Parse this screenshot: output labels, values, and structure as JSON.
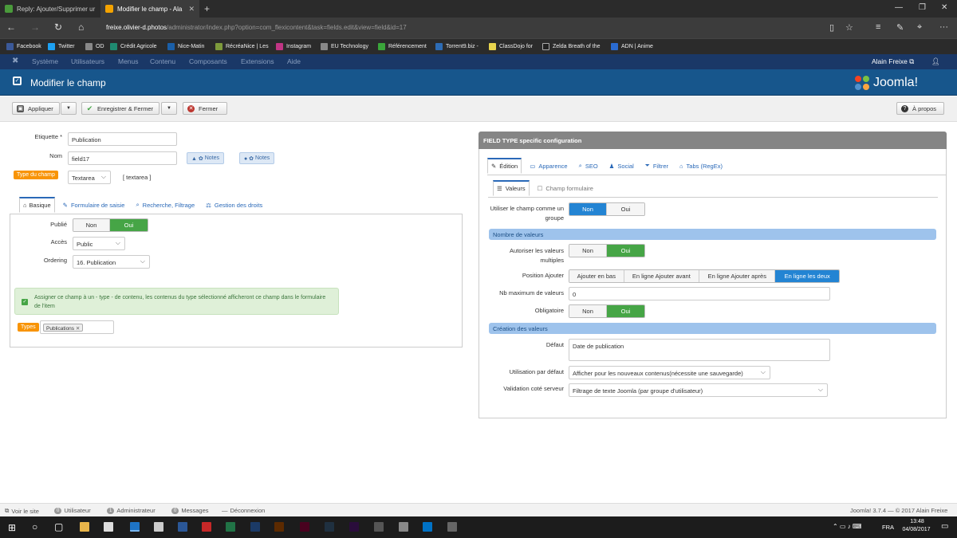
{
  "browser": {
    "tabs": [
      {
        "label": "Reply: Ajouter/Supprimer ur",
        "favicon_color": "#4a9a3b"
      },
      {
        "label": "Modifier le champ - Ala",
        "favicon_color": "#f4a300"
      }
    ],
    "new_tab": "+",
    "url_domain": "freixe.olivier-d.photos",
    "url_path": "/administrator/index.php?option=com_flexicontent&task=fields.edit&view=field&id=17",
    "url_prefix": "freixe.",
    "favorites": [
      {
        "label": "Facebook",
        "color": "#3b5998"
      },
      {
        "label": "Twitter",
        "color": "#1da1f2"
      },
      {
        "label": "OD",
        "color": "#888888"
      },
      {
        "label": "Crédit Agricole",
        "color": "#1f8a70"
      },
      {
        "label": "Nice-Matin",
        "color": "#1a5fa8"
      },
      {
        "label": "RécréaNice | Les",
        "color": "#7d9a3b"
      },
      {
        "label": "Instagram",
        "color": "#c13584"
      },
      {
        "label": "EU Technology",
        "color": "#888888"
      },
      {
        "label": "Référencement",
        "color": "#3aa63a"
      },
      {
        "label": "Torrent9.biz -",
        "color": "#2d6cb5"
      },
      {
        "label": "ClassDojo for",
        "color": "#e8d44d"
      },
      {
        "label": "Zelda Breath of the",
        "color": "#222222"
      },
      {
        "label": "ADN | Anime",
        "color": "#2a6bd1"
      }
    ]
  },
  "jmenu": {
    "items": [
      "Système",
      "Utilisateurs",
      "Menus",
      "Contenu",
      "Composants",
      "Extensions",
      "Aide"
    ],
    "user": "Alain Freixe"
  },
  "header": {
    "title": "Modifier le champ",
    "logo_text": "Joomla!"
  },
  "toolbar": {
    "apply": "Appliquer",
    "save_close": "Enregistrer & Fermer",
    "close": "Fermer",
    "about": "À propos"
  },
  "left": {
    "label_etiquette": "Etiquette *",
    "etiquette_value": "Publication",
    "label_nom": "Nom",
    "nom_value": "field17",
    "notes1": "Notes",
    "notes2": "Notes",
    "type_badge": "Type du champ",
    "type_value": "Textarea",
    "type_code": "[ textarea ]",
    "tabs": [
      "Basique",
      "Formulaire de saisie",
      "Recherche, Filtrage",
      "Gestion des droits"
    ],
    "label_publie": "Publié",
    "publie_non": "Non",
    "publie_oui": "Oui",
    "label_acces": "Accès",
    "acces_value": "Public",
    "label_ordering": "Ordering",
    "ordering_value": "16. Publication",
    "info_text": "Assigner ce champ à un - type - de contenu, les contenus du type sélectionné afficheront ce champ dans le formulaire de l'item",
    "types_badge": "Types",
    "types_chip": "Publications"
  },
  "right": {
    "panel_title": "FIELD TYPE specific configuration",
    "tabs": [
      "Édition",
      "Apparence",
      "SEO",
      "Social",
      "Filtrer",
      "Tabs (RegEx)"
    ],
    "subtabs": [
      "Valeurs",
      "Champ formulaire"
    ],
    "label_group": "Utiliser le champ comme un groupe",
    "group_non": "Non",
    "group_oui": "Oui",
    "section_nombre": "Nombre de valeurs",
    "label_multiples": "Autoriser les valeurs multiples",
    "multi_non": "Non",
    "multi_oui": "Oui",
    "label_position": "Position Ajouter",
    "position_opts": [
      "Ajouter en bas",
      "En ligne Ajouter avant",
      "En ligne Ajouter après",
      "En ligne les deux"
    ],
    "label_max": "Nb maximum de valeurs",
    "max_value": "0",
    "label_obligatoire": "Obligatoire",
    "obl_non": "Non",
    "obl_oui": "Oui",
    "section_creation": "Création des valeurs",
    "label_defaut": "Défaut",
    "defaut_value": "Date de publication",
    "label_usage": "Utilisation par défaut",
    "usage_value": "Afficher pour les nouveaux contenus(nécessite une sauvegarde)",
    "label_validation": "Validation coté serveur",
    "validation_value": "Filtrage de texte Joomla (par groupe d'utilisateur)"
  },
  "footer": {
    "voir": "Voir le site",
    "users_count": "0",
    "users": "Utilisateur",
    "admin_count": "1",
    "admin": "Administrateur",
    "msg_count": "0",
    "messages": "Messages",
    "logout": "Déconnexion",
    "version": "Joomla! 3.7.4  —  © 2017 Alain Freixe"
  },
  "taskbar": {
    "lang": "FRA",
    "time": "13:48",
    "date": "04/08/2017"
  },
  "colors": {
    "joomla_menu": "#1a3867",
    "joomla_header": "#17568c",
    "toggle_green": "#46a546",
    "toggle_blue": "#2384d3",
    "badge_orange": "#f89406",
    "section_blue": "#9ec3ec"
  }
}
